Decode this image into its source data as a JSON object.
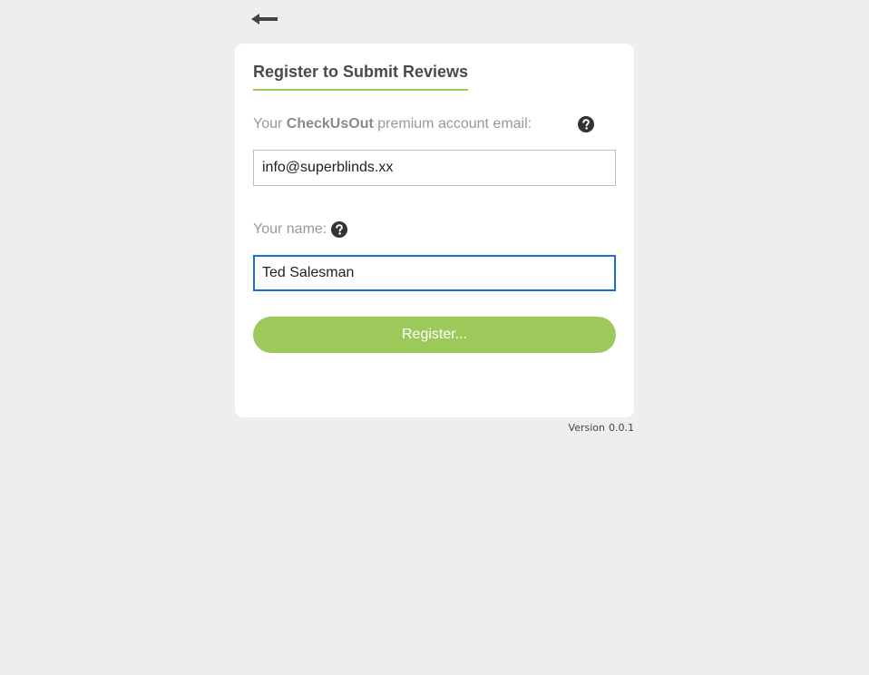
{
  "nav": {
    "back_icon": "arrow-left-icon"
  },
  "form": {
    "title": "Register to Submit Reviews",
    "email_label_prefix": "Your ",
    "email_label_brand": "CheckUsOut",
    "email_label_suffix": " premium account email:",
    "email_help_icon": "question-circle-icon",
    "email_value": "info@superblinds.xx",
    "name_label": "Your name:",
    "name_help_icon": "question-circle-icon",
    "name_value": "Ted Salesman",
    "name_focused": true,
    "submit_label": "Register..."
  },
  "footer": {
    "version_label": "Version",
    "version_number": "0.0.1"
  },
  "colors": {
    "background": "#eeeeee",
    "card": "#ffffff",
    "accent": "#9cc95a",
    "focus_border": "#1a6fd0",
    "label_text": "#999999",
    "title_text": "#4a4a4a"
  }
}
